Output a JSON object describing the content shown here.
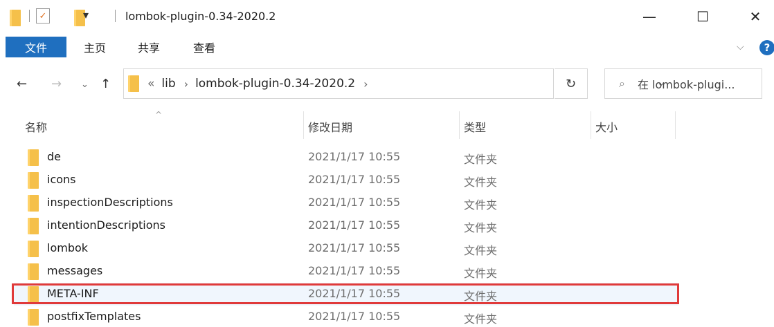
{
  "window": {
    "title": "lombok-plugin-0.34-2020.2",
    "minimize_glyph": "—",
    "maximize_glyph": "☐",
    "close_glyph": "✕"
  },
  "ribbon": {
    "tabs": [
      {
        "label": "文件"
      },
      {
        "label": "主页"
      },
      {
        "label": "共享"
      },
      {
        "label": "查看"
      }
    ],
    "help_glyph": "?"
  },
  "nav": {
    "breadcrumb_overflow": "«",
    "breadcrumbs": [
      "lib",
      "lombok-plugin-0.34-2020.2"
    ],
    "search_placeholder": "在 lombok-plugi..."
  },
  "columns": {
    "name": "名称",
    "date": "修改日期",
    "type": "类型",
    "size": "大小"
  },
  "files": [
    {
      "name": "de",
      "date": "2021/1/17 10:55",
      "type": "文件夹"
    },
    {
      "name": "icons",
      "date": "2021/1/17 10:55",
      "type": "文件夹"
    },
    {
      "name": "inspectionDescriptions",
      "date": "2021/1/17 10:55",
      "type": "文件夹"
    },
    {
      "name": "intentionDescriptions",
      "date": "2021/1/17 10:55",
      "type": "文件夹"
    },
    {
      "name": "lombok",
      "date": "2021/1/17 10:55",
      "type": "文件夹"
    },
    {
      "name": "messages",
      "date": "2021/1/17 10:55",
      "type": "文件夹"
    },
    {
      "name": "META-INF",
      "date": "2021/1/17 10:55",
      "type": "文件夹"
    },
    {
      "name": "postfixTemplates",
      "date": "2021/1/17 10:55",
      "type": "文件夹"
    }
  ],
  "colors": {
    "accent": "#1f6fbf",
    "highlight_border": "#e03a3a",
    "folder": "#f5c04a"
  }
}
